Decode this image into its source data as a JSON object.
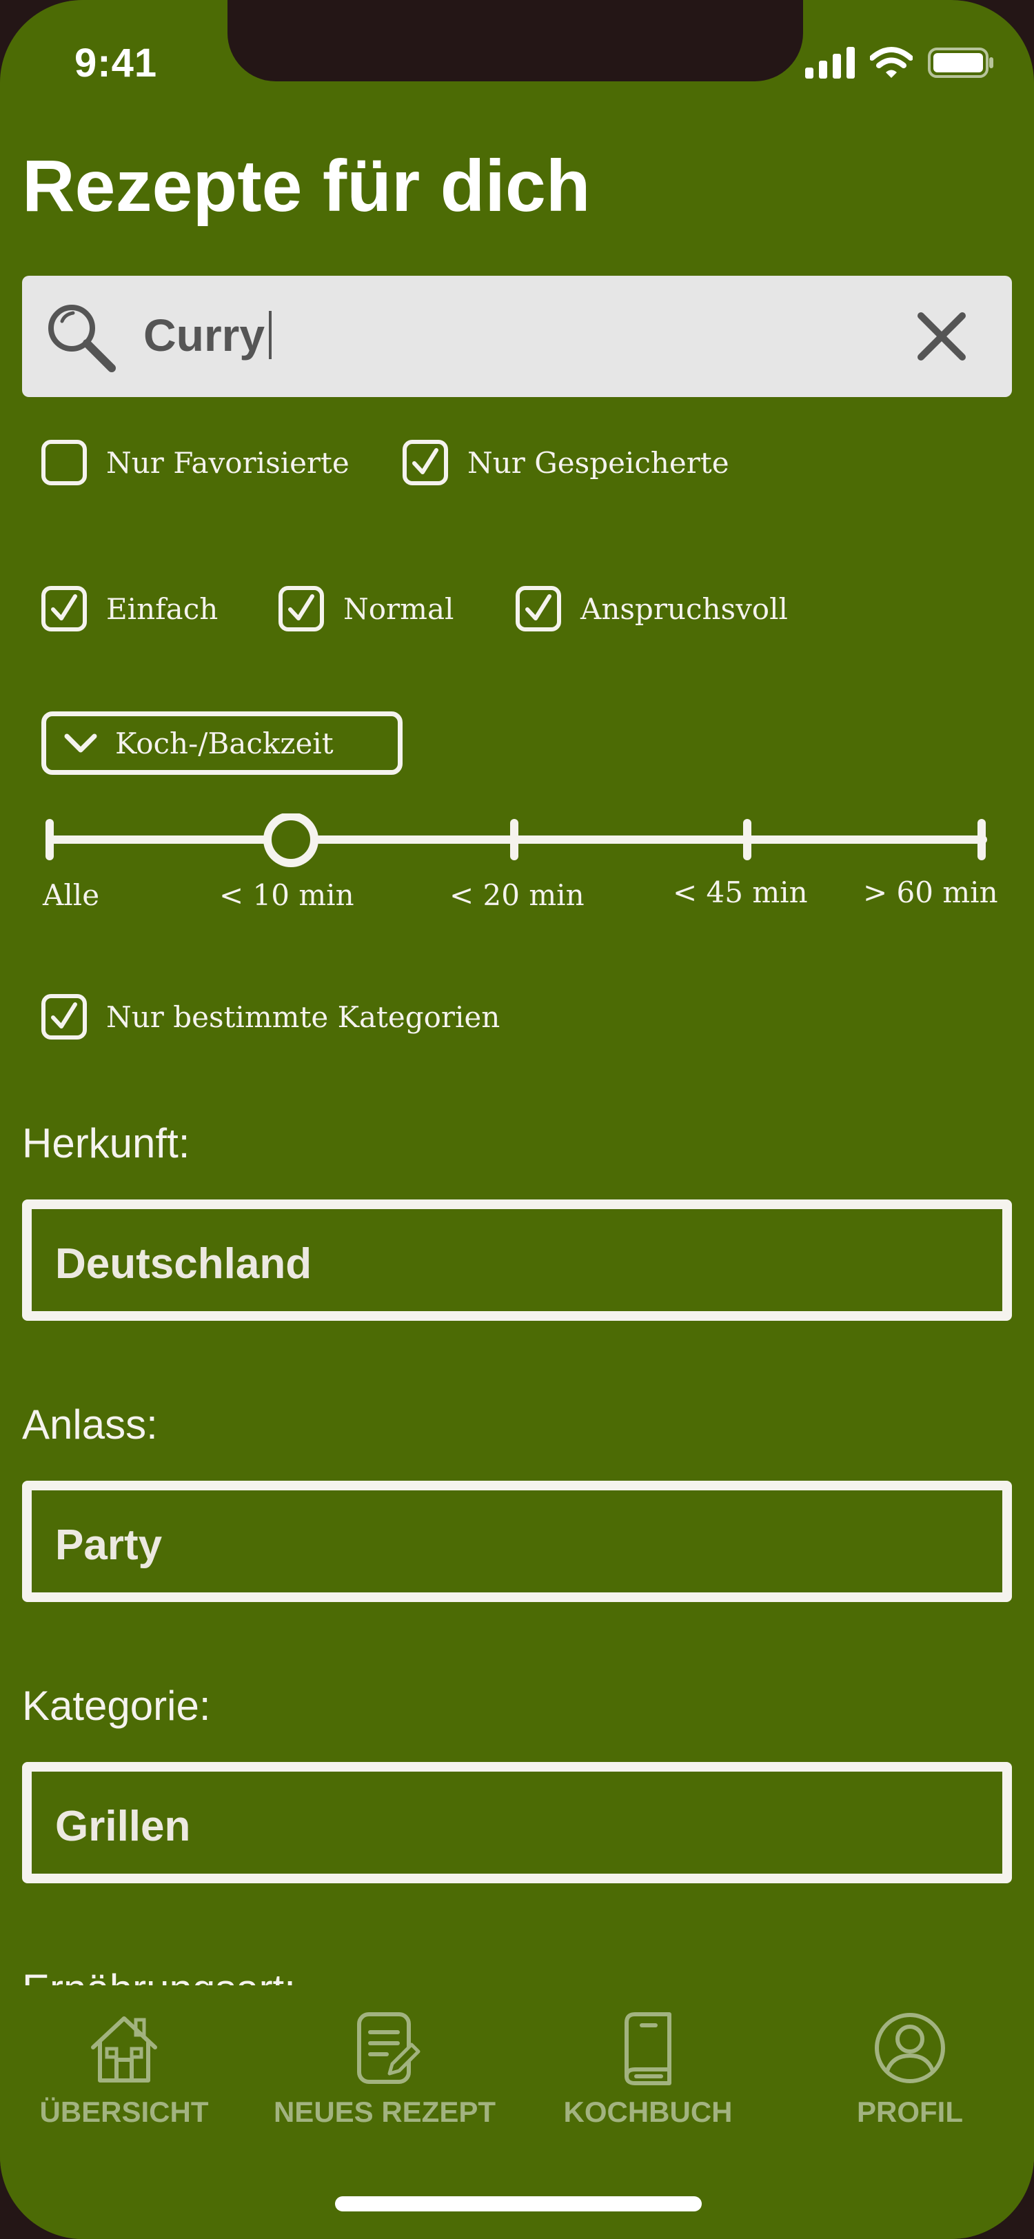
{
  "status_bar": {
    "time": "9:41"
  },
  "page": {
    "title": "Rezepte für dich"
  },
  "search": {
    "value": "Curry",
    "search_icon": "search-icon",
    "clear_icon": "close-icon"
  },
  "filters": {
    "favorites": {
      "label": "Nur Favorisierte",
      "checked": false
    },
    "saved": {
      "label": "Nur Gespeicherte",
      "checked": true
    },
    "difficulty": [
      {
        "label": "Einfach",
        "checked": true
      },
      {
        "label": "Normal",
        "checked": true
      },
      {
        "label": "Anspruchsvoll",
        "checked": true
      }
    ],
    "time_dropdown": {
      "label": "Koch-/Backzeit"
    },
    "time_slider": {
      "stops": [
        "Alle",
        "< 10 min",
        "< 20 min",
        "< 45 min",
        "> 60 min"
      ],
      "selected": "< 10 min"
    },
    "categories_only": {
      "label": "Nur bestimmte Kategorien",
      "checked": true
    }
  },
  "categories": {
    "origin": {
      "label": "Herkunft:",
      "value": "Deutschland"
    },
    "occasion": {
      "label": "Anlass:",
      "value": "Party"
    },
    "category": {
      "label": "Kategorie:",
      "value": "Grillen"
    },
    "diet": {
      "label": "Ernährungsart:"
    }
  },
  "tabbar": {
    "items": [
      {
        "label": "ÜBERSICHT",
        "icon": "home-icon"
      },
      {
        "label": "NEUES REZEPT",
        "icon": "edit-document-icon"
      },
      {
        "label": "KOCHBUCH",
        "icon": "book-icon"
      },
      {
        "label": "PROFIL",
        "icon": "user-icon"
      }
    ]
  },
  "colors": {
    "background": "#4c6b05",
    "foreground": "#f5f3ee",
    "search_background": "#e6e6e6",
    "tab_inactive": "#a2b380"
  }
}
